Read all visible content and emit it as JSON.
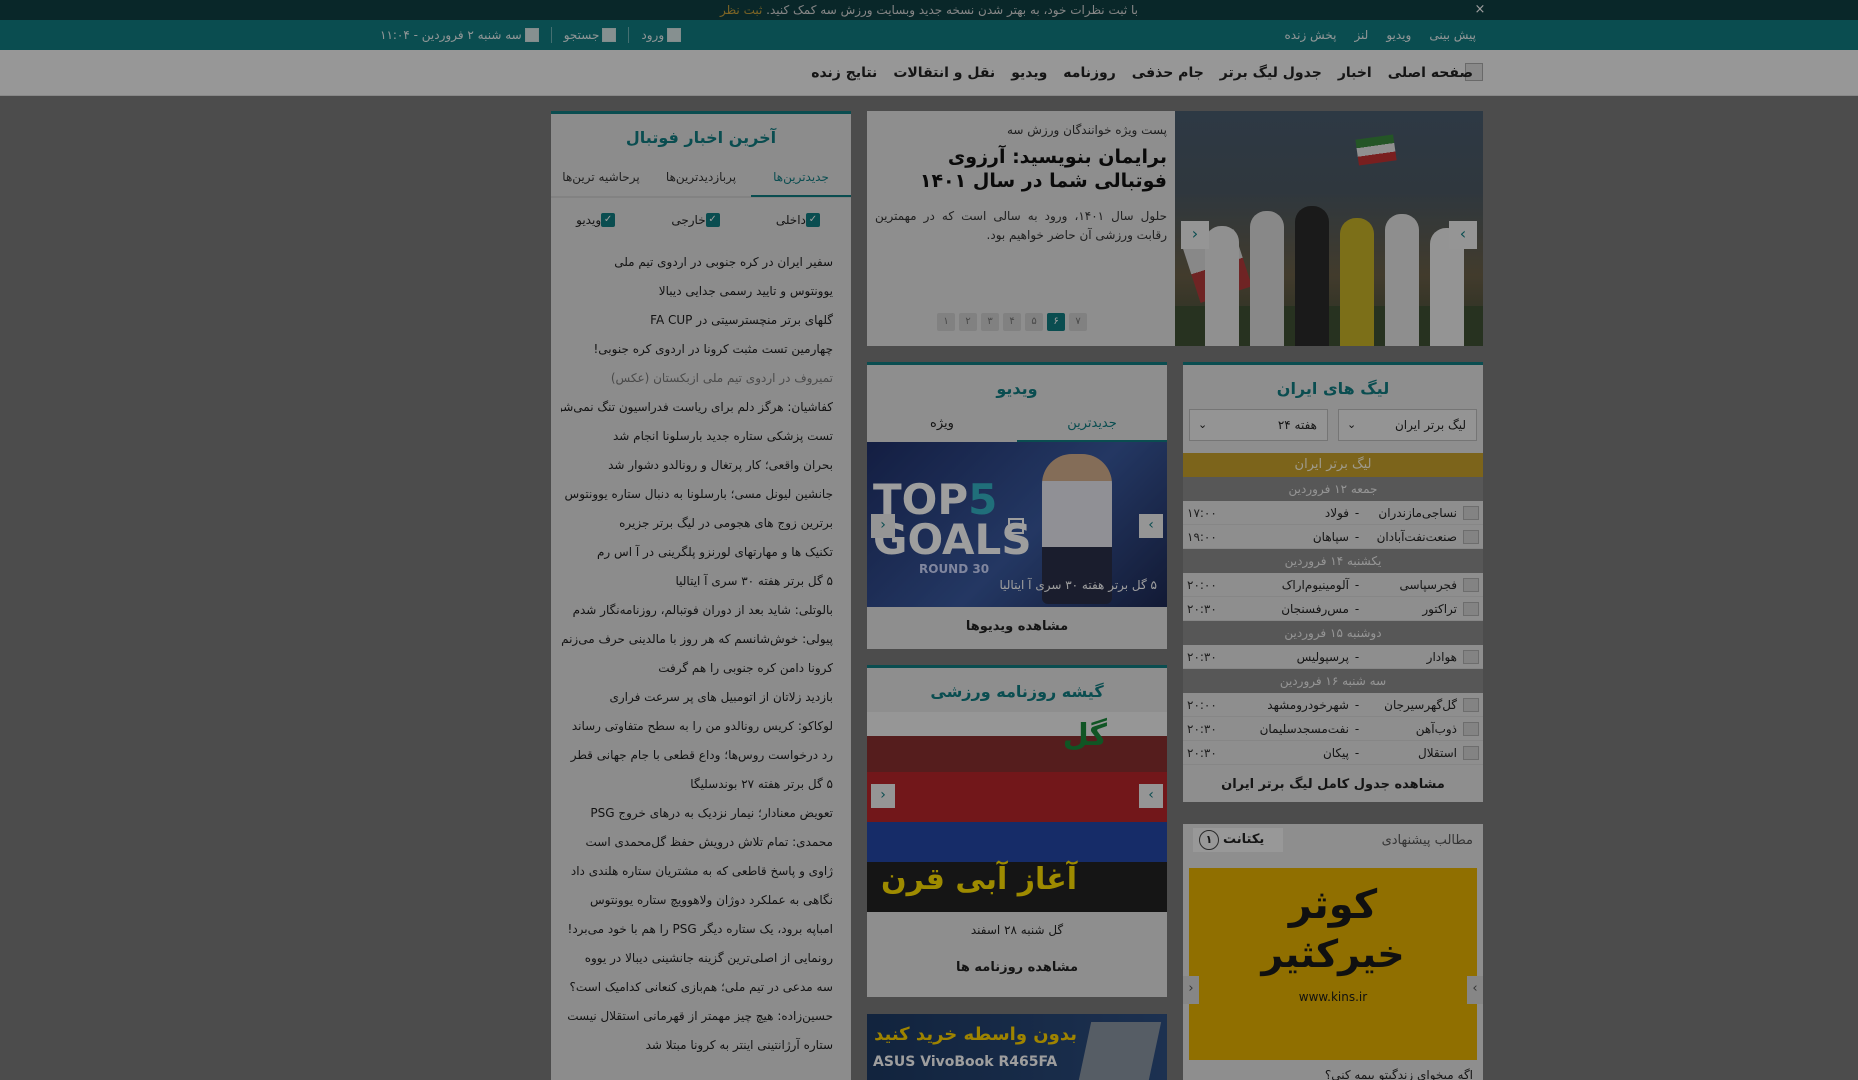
{
  "notice": {
    "text": "با ثبت نظرات خود، به بهتر شدن نسخه جدید وبسایت ورزش سه کمک کنید.",
    "link": "ثبت نظر",
    "close": "×"
  },
  "utilbar": {
    "links": [
      "پیش بینی",
      "ویدیو",
      "لنز",
      "پخش زنده"
    ],
    "date": "سه شنبه ۲ فروردین - ۱۱:۰۴",
    "search": "جستجو",
    "login": "ورود"
  },
  "nav": {
    "items": [
      "صفحه اصلی",
      "اخبار",
      "جدول لیگ برتر",
      "جام حذفی",
      "روزنامه",
      "ویدیو",
      "نقل و انتقالات",
      "نتایج زنده"
    ]
  },
  "slider": {
    "kicker": "پست ویژه خوانندگان ورزش سه",
    "headline": "برایمان بنویسید: آرزوی فوتبالی شما در سال ۱۴۰۱",
    "lead": "حلول سال ۱۴۰۱، ورود به سالی است که در مهمترین رقابت ورزشی آن حاضر خواهیم بود.",
    "dots": [
      "۱",
      "۲",
      "۳",
      "۴",
      "۵",
      "۶",
      "۷"
    ],
    "active_dot": 5
  },
  "news": {
    "title": "آخرین اخبار فوتبال",
    "tabs": [
      "جدیدترین‌ها",
      "پربازدیدترین‌ها",
      "پرحاشیه ترین‌ها"
    ],
    "filters": [
      "داخلی",
      "خارجی",
      "ویدیو"
    ],
    "items": [
      "سفیر ایران در کره جنوبی در اردوی تیم ملی",
      "یوونتوس و تایید رسمی جدایی دیبالا",
      "گلهای برتر منچسترسیتی در FA CUP",
      "چهارمین تست مثبت کرونا در اردوی کره جنوبی!",
      "تمیروف در اردوی تیم ملی ازبکستان (عکس)",
      "کفاشیان: هرگز دلم برای ریاست فدراسیون تنگ نمی‌شود",
      "تست پزشکی ستاره جدید بارسلونا انجام شد",
      "بحران واقعی؛ کار پرتغال و رونالدو دشوار شد",
      "جانشین لیونل مسی؛ بارسلونا به دنبال ستاره یوونتوس",
      "برترین زوج های هجومی در لیگ برتر جزیره",
      "تکنیک ها و مهارتهای لورنزو پلگرینی در آ اس رم",
      "۵ گل برتر هفته ۳۰ سری آ ایتالیا",
      "بالوتلی: شاید بعد از دوران فوتبالم، روزنامه‌نگار شدم",
      "پیولی: خوش‌شانسم که هر روز با مالدینی حرف می‌زنم",
      "کرونا دامن کره جنوبی را هم گرفت",
      "بازدید زلاتان از اتومبیل های پر سرعت فراری",
      "لوکاکو: کریس رونالدو من را به سطح متفاوتی رساند",
      "رد درخواست روس‌ها؛ وداع قطعی با جام جهانی قطر",
      "۵ گل برتر هفته ۲۷ بوندسلیگا",
      "تعویض معنادار؛ نیمار نزدیک به درهای خروج PSG",
      "محمدی: تمام تلاش درویش حفظ گل‌محمدی است",
      "ژاوی و پاسخ قاطعی که به مشتریان ستاره هلندی داد",
      "نگاهی به عملکرد دوژان ولاهوویچ ستاره یوونتوس",
      "امباپه برود، یک ستاره دیگر PSG را هم با خود می‌برد!",
      "رونمایی از اصلی‌ترین گزینه جانشینی دیبالا در یووه",
      "سه مدعی در تیم ملی؛ هم‌بازی کنعانی کدامیک است؟",
      "حسین‌زاده: هیچ چیز مهمتر از قهرمانی استقلال نیست",
      "ستاره آرژانتینی اینتر به کرونا مبتلا شد"
    ]
  },
  "video": {
    "title": "ویدیو",
    "tabs": [
      "جدیدترین",
      "ویژه"
    ],
    "top": "TOP",
    "five": "5",
    "goals": "GOALS",
    "round": "ROUND 30",
    "caption": "۵ گل برتر هفته ۳۰ سری آ ایتالیا",
    "link": "مشاهده ویدیوها"
  },
  "paper": {
    "title": "گیشه روزنامه ورزشی",
    "headline": "آغاز آبی قرن",
    "caption": "گل شنبه ۲۸ اسفند",
    "link": "مشاهده روزنامه ها"
  },
  "ad1": {
    "line1": "بدون واسطه خرید کنید",
    "line2": "ASUS VivoBook R465FA"
  },
  "league": {
    "title": "لیگ های ایران",
    "select_league": "لیگ برتر ایران",
    "select_week": "هفته ۲۴",
    "bar": "لیگ برتر ایران",
    "days": [
      {
        "label": "جمعه ۱۲ فروردین",
        "matches": [
          {
            "home": "نساجی‌مازندران",
            "away": "فولاد",
            "time": "۱۷:۰۰"
          },
          {
            "home": "صنعت‌نفت‌آبادان",
            "away": "سپاهان",
            "time": "۱۹:۰۰"
          }
        ]
      },
      {
        "label": "یکشنبه ۱۴ فروردین",
        "matches": [
          {
            "home": "فجرسپاسی",
            "away": "آلومینیوم‌اراک",
            "time": "۲۰:۰۰"
          },
          {
            "home": "تراکتور",
            "away": "مس‌رفسنجان",
            "time": "۲۰:۳۰"
          }
        ]
      },
      {
        "label": "دوشنبه ۱۵ فروردین",
        "matches": [
          {
            "home": "هوادار",
            "away": "پرسپولیس",
            "time": "۲۰:۳۰"
          }
        ]
      },
      {
        "label": "سه شنبه ۱۶ فروردین",
        "matches": [
          {
            "home": "گل‌گهرسیرجان",
            "away": "شهرخودرومشهد",
            "time": "۲۰:۰۰"
          },
          {
            "home": "ذوب‌آهن",
            "away": "نفت‌مسجدسلیمان",
            "time": "۲۰:۳۰"
          },
          {
            "home": "استقلال",
            "away": "پیکان",
            "time": "۲۰:۳۰"
          }
        ]
      }
    ],
    "link": "مشاهده جدول کامل لیگ برتر ایران"
  },
  "suggest": {
    "title": "مطالب پیشنهادی",
    "brand": "یکتانت",
    "badge": "۱",
    "ad_line1": "کوثر",
    "ad_line2": "خیرکثیر",
    "ad_line3": "www.kins.ir",
    "bottom": "اگه میخوای زندگیتو بیمه کنی؟"
  },
  "colors": {
    "teal": "#117c82",
    "gold": "#c9a22c",
    "yellow_ad": "#e9b400"
  }
}
